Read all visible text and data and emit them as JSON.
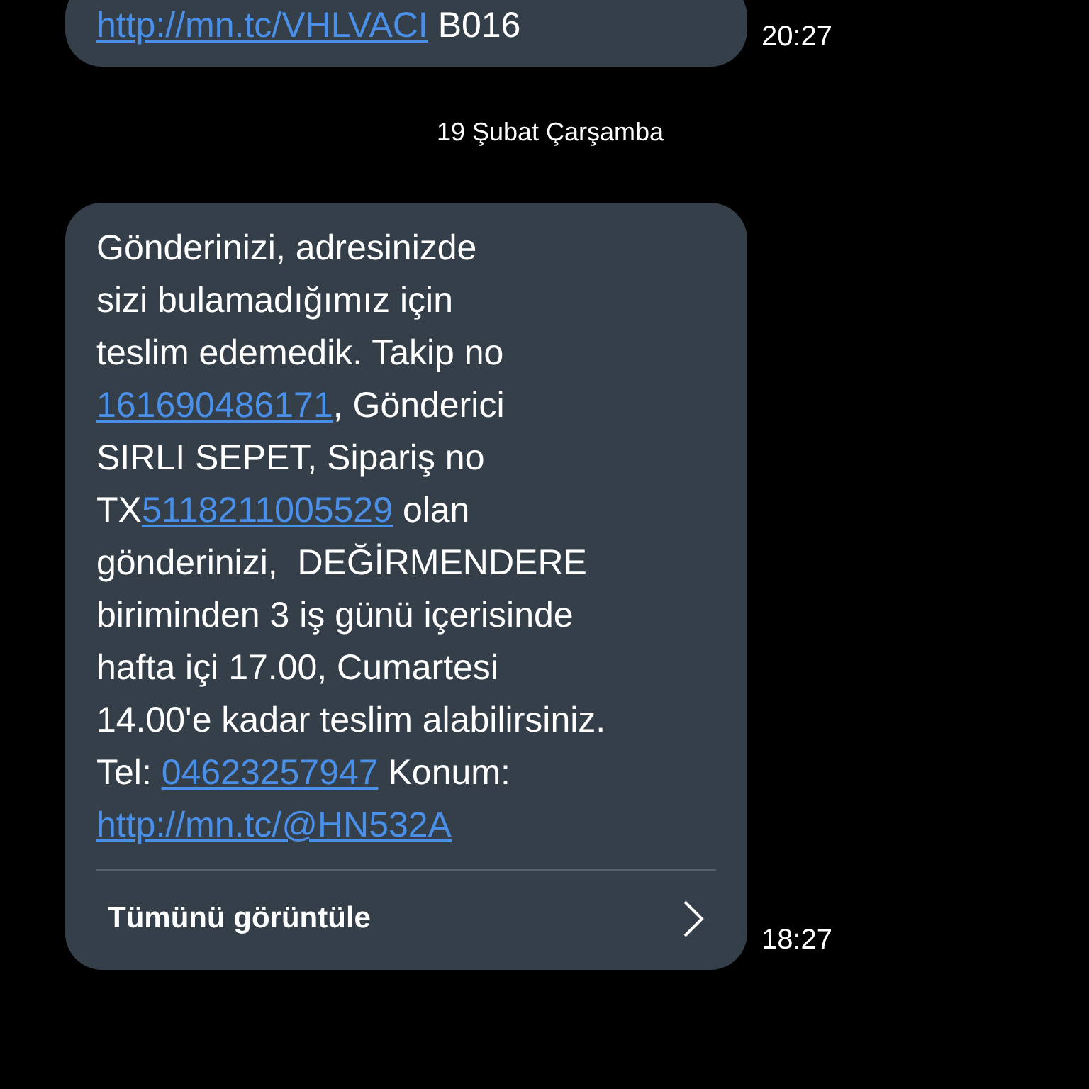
{
  "messages": [
    {
      "lines": [
        [
          {
            "kind": "link",
            "text": "http://mn.tc/VHLVACI"
          },
          {
            "kind": "text",
            "text": " B016"
          }
        ]
      ],
      "time": "20:27"
    },
    {
      "date_divider": "19 Şubat Çarşamba",
      "lines": [
        [
          {
            "kind": "text",
            "text": "Gönderinizi, adresinizde"
          }
        ],
        [
          {
            "kind": "text",
            "text": "sizi bulamadığımız için"
          }
        ],
        [
          {
            "kind": "text",
            "text": "teslim edemedik. Takip no"
          }
        ],
        [
          {
            "kind": "link",
            "text": "161690486171"
          },
          {
            "kind": "text",
            "text": ", Gönderici"
          }
        ],
        [
          {
            "kind": "text",
            "text": "SIRLI SEPET, Sipariş no"
          }
        ],
        [
          {
            "kind": "text",
            "text": "TX"
          },
          {
            "kind": "link",
            "text": "5118211005529"
          },
          {
            "kind": "text",
            "text": " olan"
          }
        ],
        [
          {
            "kind": "text",
            "text": "gönderinizi,  DEĞİRMENDERE"
          }
        ],
        [
          {
            "kind": "text",
            "text": "biriminden 3 iş günü içerisinde"
          }
        ],
        [
          {
            "kind": "text",
            "text": "hafta içi 17.00, Cumartesi"
          }
        ],
        [
          {
            "kind": "text",
            "text": "14.00'e kadar teslim alabilirsiniz."
          }
        ],
        [
          {
            "kind": "text",
            "text": "Tel: "
          },
          {
            "kind": "link",
            "text": "04623257947"
          },
          {
            "kind": "text",
            "text": " Konum:"
          }
        ],
        [
          {
            "kind": "link",
            "text": "http://mn.tc/@HN532A"
          }
        ]
      ],
      "view_all": "Tümünü görüntüle",
      "time": "18:27"
    }
  ]
}
